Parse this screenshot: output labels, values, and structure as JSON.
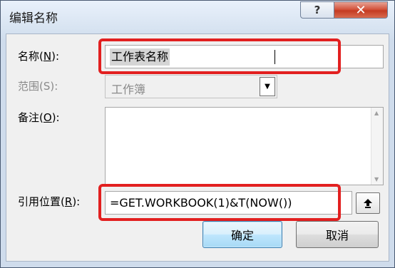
{
  "window": {
    "title": "编辑名称",
    "help_glyph": "?",
    "close_glyph": "✕"
  },
  "fields": {
    "name": {
      "label": "名称",
      "key": "N",
      "value": "工作表名称"
    },
    "scope": {
      "label": "范围",
      "key": "S",
      "value": "工作簿"
    },
    "comment": {
      "label": "备注",
      "key": "O",
      "value": ""
    },
    "refers_to": {
      "label": "引用位置",
      "key": "R",
      "value": "=GET.WORKBOOK(1)&T(NOW())"
    }
  },
  "buttons": {
    "ok": "确定",
    "cancel": "取消"
  },
  "colors": {
    "highlight": "#e22020",
    "ok_border": "#3c7fb1"
  }
}
